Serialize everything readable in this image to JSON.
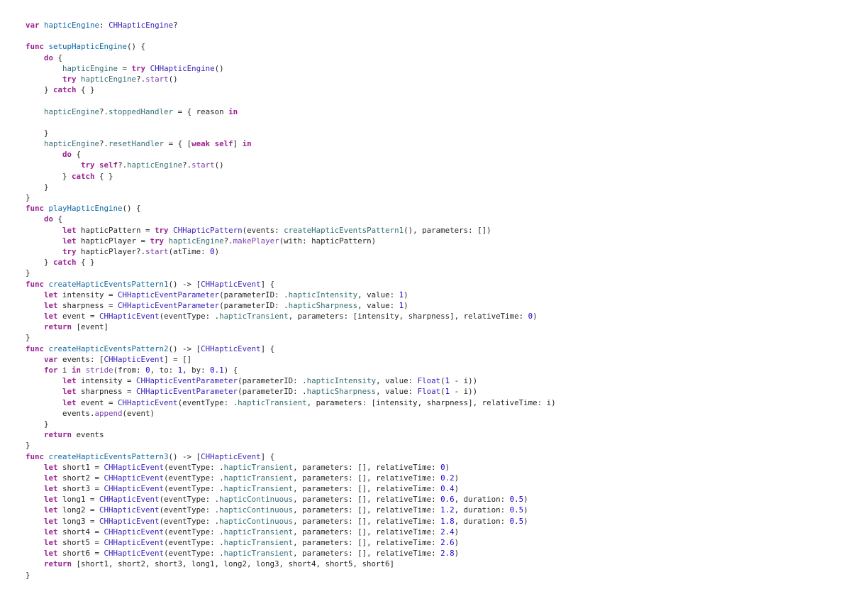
{
  "editor": {
    "language": "swift",
    "lines": [
      [
        [
          "kw",
          "var"
        ],
        [
          "p",
          " "
        ],
        [
          "def",
          "hapticEngine"
        ],
        [
          "p",
          ": "
        ],
        [
          "type",
          "CHHapticEngine"
        ],
        [
          "p",
          "?"
        ]
      ],
      [],
      [
        [
          "kw",
          "func"
        ],
        [
          "p",
          " "
        ],
        [
          "def",
          "setupHapticEngine"
        ],
        [
          "p",
          "() {"
        ]
      ],
      [
        [
          "p",
          "    "
        ],
        [
          "kw",
          "do"
        ],
        [
          "p",
          " {"
        ]
      ],
      [
        [
          "p",
          "        "
        ],
        [
          "prop",
          "hapticEngine"
        ],
        [
          "p",
          " = "
        ],
        [
          "kw",
          "try"
        ],
        [
          "p",
          " "
        ],
        [
          "type",
          "CHHapticEngine"
        ],
        [
          "p",
          "()"
        ]
      ],
      [
        [
          "p",
          "        "
        ],
        [
          "kw",
          "try"
        ],
        [
          "p",
          " "
        ],
        [
          "prop",
          "hapticEngine"
        ],
        [
          "p",
          "?."
        ],
        [
          "fn",
          "start"
        ],
        [
          "p",
          "()"
        ]
      ],
      [
        [
          "p",
          "    } "
        ],
        [
          "kw",
          "catch"
        ],
        [
          "p",
          " { }"
        ]
      ],
      [],
      [
        [
          "p",
          "    "
        ],
        [
          "prop",
          "hapticEngine"
        ],
        [
          "p",
          "?."
        ],
        [
          "prop",
          "stoppedHandler"
        ],
        [
          "p",
          " = { reason "
        ],
        [
          "kw",
          "in"
        ]
      ],
      [],
      [
        [
          "p",
          "    }"
        ]
      ],
      [
        [
          "p",
          "    "
        ],
        [
          "prop",
          "hapticEngine"
        ],
        [
          "p",
          "?."
        ],
        [
          "prop",
          "resetHandler"
        ],
        [
          "p",
          " = { ["
        ],
        [
          "kw",
          "weak"
        ],
        [
          "p",
          " "
        ],
        [
          "kw",
          "self"
        ],
        [
          "p",
          "] "
        ],
        [
          "kw",
          "in"
        ]
      ],
      [
        [
          "p",
          "        "
        ],
        [
          "kw",
          "do"
        ],
        [
          "p",
          " {"
        ]
      ],
      [
        [
          "p",
          "            "
        ],
        [
          "kw",
          "try"
        ],
        [
          "p",
          " "
        ],
        [
          "kw",
          "self"
        ],
        [
          "p",
          "?."
        ],
        [
          "prop",
          "hapticEngine"
        ],
        [
          "p",
          "?."
        ],
        [
          "fn",
          "start"
        ],
        [
          "p",
          "()"
        ]
      ],
      [
        [
          "p",
          "        } "
        ],
        [
          "kw",
          "catch"
        ],
        [
          "p",
          " { }"
        ]
      ],
      [
        [
          "p",
          "    }"
        ]
      ],
      [
        [
          "p",
          "}"
        ]
      ],
      [
        [
          "kw",
          "func"
        ],
        [
          "p",
          " "
        ],
        [
          "def",
          "playHapticEngine"
        ],
        [
          "p",
          "() {"
        ]
      ],
      [
        [
          "p",
          "    "
        ],
        [
          "kw",
          "do"
        ],
        [
          "p",
          " {"
        ]
      ],
      [
        [
          "p",
          "        "
        ],
        [
          "kw",
          "let"
        ],
        [
          "p",
          " hapticPattern = "
        ],
        [
          "kw",
          "try"
        ],
        [
          "p",
          " "
        ],
        [
          "type",
          "CHHapticPattern"
        ],
        [
          "p",
          "(events: "
        ],
        [
          "prop",
          "createHapticEventsPattern1"
        ],
        [
          "p",
          "(), parameters: [])"
        ]
      ],
      [
        [
          "p",
          "        "
        ],
        [
          "kw",
          "let"
        ],
        [
          "p",
          " hapticPlayer = "
        ],
        [
          "kw",
          "try"
        ],
        [
          "p",
          " "
        ],
        [
          "prop",
          "hapticEngine"
        ],
        [
          "p",
          "?."
        ],
        [
          "fn",
          "makePlayer"
        ],
        [
          "p",
          "(with: hapticPattern)"
        ]
      ],
      [
        [
          "p",
          "        "
        ],
        [
          "kw",
          "try"
        ],
        [
          "p",
          " hapticPlayer?."
        ],
        [
          "fn",
          "start"
        ],
        [
          "p",
          "(atTime: "
        ],
        [
          "num",
          "0"
        ],
        [
          "p",
          ")"
        ]
      ],
      [
        [
          "p",
          "    } "
        ],
        [
          "kw",
          "catch"
        ],
        [
          "p",
          " { }"
        ]
      ],
      [
        [
          "p",
          "}"
        ]
      ],
      [
        [
          "kw",
          "func"
        ],
        [
          "p",
          " "
        ],
        [
          "def",
          "createHapticEventsPattern1"
        ],
        [
          "p",
          "() -> ["
        ],
        [
          "type",
          "CHHapticEvent"
        ],
        [
          "p",
          "] {"
        ]
      ],
      [
        [
          "p",
          "    "
        ],
        [
          "kw",
          "let"
        ],
        [
          "p",
          " intensity = "
        ],
        [
          "type",
          "CHHapticEventParameter"
        ],
        [
          "p",
          "(parameterID: ."
        ],
        [
          "prop",
          "hapticIntensity"
        ],
        [
          "p",
          ", value: "
        ],
        [
          "num",
          "1"
        ],
        [
          "p",
          ")"
        ]
      ],
      [
        [
          "p",
          "    "
        ],
        [
          "kw",
          "let"
        ],
        [
          "p",
          " sharpness = "
        ],
        [
          "type",
          "CHHapticEventParameter"
        ],
        [
          "p",
          "(parameterID: ."
        ],
        [
          "prop",
          "hapticSharpness"
        ],
        [
          "p",
          ", value: "
        ],
        [
          "num",
          "1"
        ],
        [
          "p",
          ")"
        ]
      ],
      [
        [
          "p",
          "    "
        ],
        [
          "kw",
          "let"
        ],
        [
          "p",
          " event = "
        ],
        [
          "type",
          "CHHapticEvent"
        ],
        [
          "p",
          "(eventType: ."
        ],
        [
          "prop",
          "hapticTransient"
        ],
        [
          "p",
          ", parameters: [intensity, sharpness], relativeTime: "
        ],
        [
          "num",
          "0"
        ],
        [
          "p",
          ")"
        ]
      ],
      [
        [
          "p",
          "    "
        ],
        [
          "kw",
          "return"
        ],
        [
          "p",
          " [event]"
        ]
      ],
      [
        [
          "p",
          "}"
        ]
      ],
      [
        [
          "kw",
          "func"
        ],
        [
          "p",
          " "
        ],
        [
          "def",
          "createHapticEventsPattern2"
        ],
        [
          "p",
          "() -> ["
        ],
        [
          "type",
          "CHHapticEvent"
        ],
        [
          "p",
          "] {"
        ]
      ],
      [
        [
          "p",
          "    "
        ],
        [
          "kw",
          "var"
        ],
        [
          "p",
          " events: ["
        ],
        [
          "type",
          "CHHapticEvent"
        ],
        [
          "p",
          "] = []"
        ]
      ],
      [
        [
          "p",
          "    "
        ],
        [
          "kw",
          "for"
        ],
        [
          "p",
          " i "
        ],
        [
          "kw",
          "in"
        ],
        [
          "p",
          " "
        ],
        [
          "fn",
          "stride"
        ],
        [
          "p",
          "(from: "
        ],
        [
          "num",
          "0"
        ],
        [
          "p",
          ", to: "
        ],
        [
          "num",
          "1"
        ],
        [
          "p",
          ", by: "
        ],
        [
          "num",
          "0.1"
        ],
        [
          "p",
          ") {"
        ]
      ],
      [
        [
          "p",
          "        "
        ],
        [
          "kw",
          "let"
        ],
        [
          "p",
          " intensity = "
        ],
        [
          "type",
          "CHHapticEventParameter"
        ],
        [
          "p",
          "(parameterID: ."
        ],
        [
          "prop",
          "hapticIntensity"
        ],
        [
          "p",
          ", value: "
        ],
        [
          "type",
          "Float"
        ],
        [
          "p",
          "("
        ],
        [
          "num",
          "1"
        ],
        [
          "p",
          " - i))"
        ]
      ],
      [
        [
          "p",
          "        "
        ],
        [
          "kw",
          "let"
        ],
        [
          "p",
          " sharpness = "
        ],
        [
          "type",
          "CHHapticEventParameter"
        ],
        [
          "p",
          "(parameterID: ."
        ],
        [
          "prop",
          "hapticSharpness"
        ],
        [
          "p",
          ", value: "
        ],
        [
          "type",
          "Float"
        ],
        [
          "p",
          "("
        ],
        [
          "num",
          "1"
        ],
        [
          "p",
          " - i))"
        ]
      ],
      [
        [
          "p",
          "        "
        ],
        [
          "kw",
          "let"
        ],
        [
          "p",
          " event = "
        ],
        [
          "type",
          "CHHapticEvent"
        ],
        [
          "p",
          "(eventType: ."
        ],
        [
          "prop",
          "hapticTransient"
        ],
        [
          "p",
          ", parameters: [intensity, sharpness], relativeTime: i)"
        ]
      ],
      [
        [
          "p",
          "        events."
        ],
        [
          "fn",
          "append"
        ],
        [
          "p",
          "(event)"
        ]
      ],
      [
        [
          "p",
          "    }"
        ]
      ],
      [
        [
          "p",
          "    "
        ],
        [
          "kw",
          "return"
        ],
        [
          "p",
          " events"
        ]
      ],
      [
        [
          "p",
          "}"
        ]
      ],
      [
        [
          "kw",
          "func"
        ],
        [
          "p",
          " "
        ],
        [
          "def",
          "createHapticEventsPattern3"
        ],
        [
          "p",
          "() -> ["
        ],
        [
          "type",
          "CHHapticEvent"
        ],
        [
          "p",
          "] {"
        ]
      ],
      [
        [
          "p",
          "    "
        ],
        [
          "kw",
          "let"
        ],
        [
          "p",
          " short1 = "
        ],
        [
          "type",
          "CHHapticEvent"
        ],
        [
          "p",
          "(eventType: ."
        ],
        [
          "prop",
          "hapticTransient"
        ],
        [
          "p",
          ", parameters: [], relativeTime: "
        ],
        [
          "num",
          "0"
        ],
        [
          "p",
          ")"
        ]
      ],
      [
        [
          "p",
          "    "
        ],
        [
          "kw",
          "let"
        ],
        [
          "p",
          " short2 = "
        ],
        [
          "type",
          "CHHapticEvent"
        ],
        [
          "p",
          "(eventType: ."
        ],
        [
          "prop",
          "hapticTransient"
        ],
        [
          "p",
          ", parameters: [], relativeTime: "
        ],
        [
          "num",
          "0.2"
        ],
        [
          "p",
          ")"
        ]
      ],
      [
        [
          "p",
          "    "
        ],
        [
          "kw",
          "let"
        ],
        [
          "p",
          " short3 = "
        ],
        [
          "type",
          "CHHapticEvent"
        ],
        [
          "p",
          "(eventType: ."
        ],
        [
          "prop",
          "hapticTransient"
        ],
        [
          "p",
          ", parameters: [], relativeTime: "
        ],
        [
          "num",
          "0.4"
        ],
        [
          "p",
          ")"
        ]
      ],
      [
        [
          "p",
          "    "
        ],
        [
          "kw",
          "let"
        ],
        [
          "p",
          " long1 = "
        ],
        [
          "type",
          "CHHapticEvent"
        ],
        [
          "p",
          "(eventType: ."
        ],
        [
          "prop",
          "hapticContinuous"
        ],
        [
          "p",
          ", parameters: [], relativeTime: "
        ],
        [
          "num",
          "0.6"
        ],
        [
          "p",
          ", duration: "
        ],
        [
          "num",
          "0.5"
        ],
        [
          "p",
          ")"
        ]
      ],
      [
        [
          "p",
          "    "
        ],
        [
          "kw",
          "let"
        ],
        [
          "p",
          " long2 = "
        ],
        [
          "type",
          "CHHapticEvent"
        ],
        [
          "p",
          "(eventType: ."
        ],
        [
          "prop",
          "hapticContinuous"
        ],
        [
          "p",
          ", parameters: [], relativeTime: "
        ],
        [
          "num",
          "1.2"
        ],
        [
          "p",
          ", duration: "
        ],
        [
          "num",
          "0.5"
        ],
        [
          "p",
          ")"
        ]
      ],
      [
        [
          "p",
          "    "
        ],
        [
          "kw",
          "let"
        ],
        [
          "p",
          " long3 = "
        ],
        [
          "type",
          "CHHapticEvent"
        ],
        [
          "p",
          "(eventType: ."
        ],
        [
          "prop",
          "hapticContinuous"
        ],
        [
          "p",
          ", parameters: [], relativeTime: "
        ],
        [
          "num",
          "1.8"
        ],
        [
          "p",
          ", duration: "
        ],
        [
          "num",
          "0.5"
        ],
        [
          "p",
          ")"
        ]
      ],
      [
        [
          "p",
          "    "
        ],
        [
          "kw",
          "let"
        ],
        [
          "p",
          " short4 = "
        ],
        [
          "type",
          "CHHapticEvent"
        ],
        [
          "p",
          "(eventType: ."
        ],
        [
          "prop",
          "hapticTransient"
        ],
        [
          "p",
          ", parameters: [], relativeTime: "
        ],
        [
          "num",
          "2.4"
        ],
        [
          "p",
          ")"
        ]
      ],
      [
        [
          "p",
          "    "
        ],
        [
          "kw",
          "let"
        ],
        [
          "p",
          " short5 = "
        ],
        [
          "type",
          "CHHapticEvent"
        ],
        [
          "p",
          "(eventType: ."
        ],
        [
          "prop",
          "hapticTransient"
        ],
        [
          "p",
          ", parameters: [], relativeTime: "
        ],
        [
          "num",
          "2.6"
        ],
        [
          "p",
          ")"
        ]
      ],
      [
        [
          "p",
          "    "
        ],
        [
          "kw",
          "let"
        ],
        [
          "p",
          " short6 = "
        ],
        [
          "type",
          "CHHapticEvent"
        ],
        [
          "p",
          "(eventType: ."
        ],
        [
          "prop",
          "hapticTransient"
        ],
        [
          "p",
          ", parameters: [], relativeTime: "
        ],
        [
          "num",
          "2.8"
        ],
        [
          "p",
          ")"
        ]
      ],
      [
        [
          "p",
          "    "
        ],
        [
          "kw",
          "return"
        ],
        [
          "p",
          " [short1, short2, short3, long1, long2, long3, short4, short5, short6]"
        ]
      ],
      [
        [
          "p",
          "}"
        ]
      ]
    ]
  },
  "colors": {
    "background": "#ffffff",
    "keyword": "#9b2393",
    "type": "#3a25b8",
    "property": "#326d74",
    "function": "#7b3fb0",
    "number": "#1c00cf",
    "declaration": "#0f68a0",
    "plain": "#262626"
  }
}
